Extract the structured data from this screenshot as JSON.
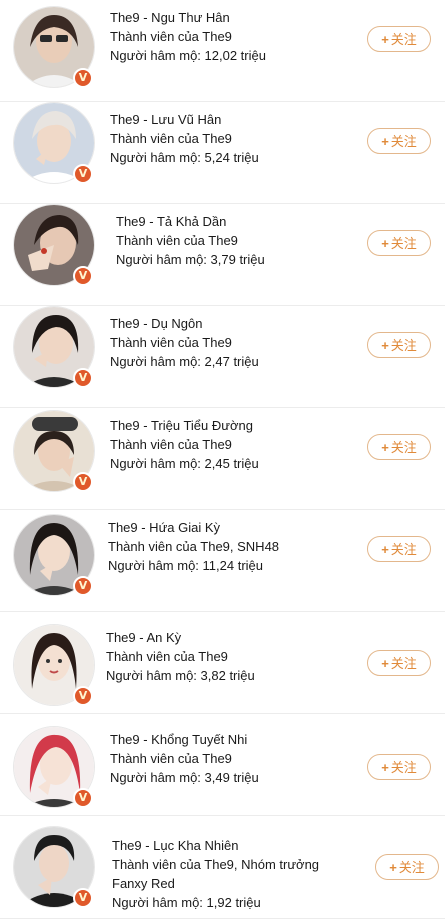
{
  "colors": {
    "accent": "#e08a3a",
    "badge": "#e0592a",
    "divider": "#ececec"
  },
  "icons": {
    "verified": "verified-v-icon",
    "follow": "plus-icon"
  },
  "items": [
    {
      "name": "The9 - Ngu Thư Hân",
      "role": "Thành viên của The9",
      "fans": "Người hâm mộ: 12,02 triệu",
      "extra": "",
      "follow_plus": "+",
      "follow_label": "关注",
      "verified_label": "V"
    },
    {
      "name": "The9 - Lưu Vũ Hân",
      "role": "Thành viên của The9",
      "fans": "Người hâm mộ: 5,24  triệu",
      "extra": "",
      "follow_plus": "+",
      "follow_label": "关注",
      "verified_label": "V"
    },
    {
      "name": "The9 - Tả Khả Dần",
      "role": "Thành viên của The9",
      "fans": "Người hâm mộ: 3,79 triệu",
      "extra": "",
      "follow_plus": "+",
      "follow_label": "关注",
      "verified_label": "V"
    },
    {
      "name": "The9 - Dụ Ngôn",
      "role": "Thành viên của The9",
      "fans": "Người hâm mộ: 2,47 triệu",
      "extra": "",
      "follow_plus": "+",
      "follow_label": "关注",
      "verified_label": "V"
    },
    {
      "name": "The9 - Triệu Tiểu Đường",
      "role": "Thành viên của The9",
      "fans": "Người hâm mộ: 2,45 triệu",
      "extra": "",
      "follow_plus": "+",
      "follow_label": "关注",
      "verified_label": "V"
    },
    {
      "name": "The9 - Hứa Giai Kỳ",
      "role": "Thành viên của The9, SNH48",
      "fans": "Người hâm mộ: 11,24 triệu",
      "extra": "",
      "follow_plus": "+",
      "follow_label": "关注",
      "verified_label": "V"
    },
    {
      "name": "The9 - An Kỳ",
      "role": "Thành viên của The9",
      "fans": "Người hâm mộ: 3,82 triệu",
      "extra": "",
      "follow_plus": "+",
      "follow_label": "关注",
      "verified_label": "V"
    },
    {
      "name": "The9 - Khổng Tuyết Nhi",
      "role": "Thành viên của The9",
      "fans": "Người hâm mộ: 3,49 triệu",
      "extra": "",
      "follow_plus": "+",
      "follow_label": "关注",
      "verified_label": "V"
    },
    {
      "name": "The9 - Lục Kha Nhiên",
      "role": "Thành viên của The9, Nhóm trưởng",
      "fans": "Người hâm mộ: 1,92 triệu",
      "extra": "Fanxy Red",
      "follow_plus": "+",
      "follow_label": "关注",
      "verified_label": "V"
    }
  ]
}
